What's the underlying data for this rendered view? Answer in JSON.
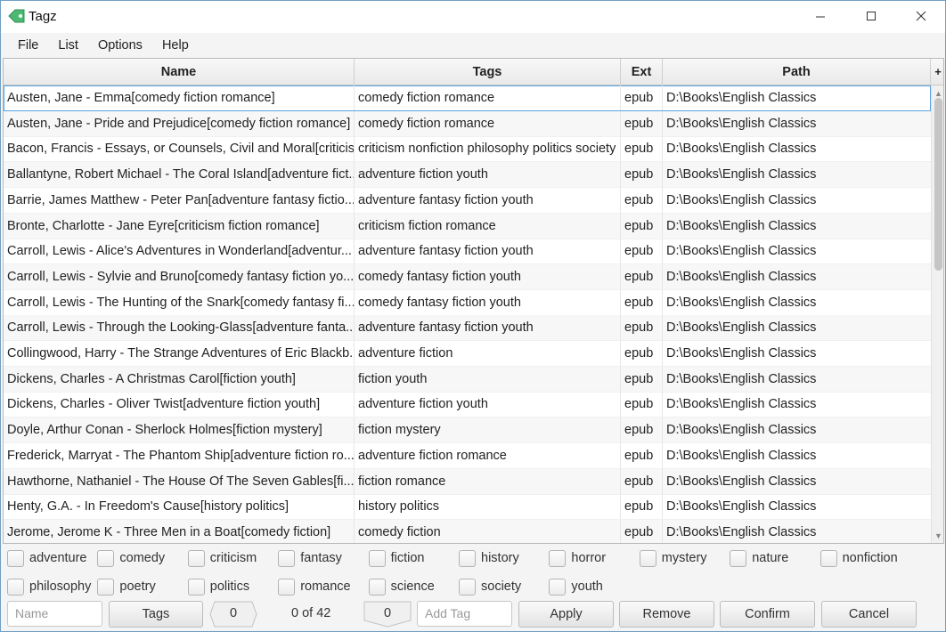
{
  "window": {
    "title": "Tagz",
    "accent": "#6f9fc4"
  },
  "menu": [
    "File",
    "List",
    "Options",
    "Help"
  ],
  "table": {
    "columns": {
      "name": "Name",
      "tags": "Tags",
      "ext": "Ext",
      "path": "Path",
      "add": "+"
    },
    "rows": [
      {
        "name": "Austen, Jane - Emma[comedy fiction romance]",
        "tags": "comedy fiction romance",
        "ext": "epub",
        "path": "D:\\Books\\English Classics"
      },
      {
        "name": "Austen, Jane - Pride and Prejudice[comedy fiction romance]",
        "tags": "comedy fiction romance",
        "ext": "epub",
        "path": "D:\\Books\\English Classics"
      },
      {
        "name": "Bacon, Francis - Essays, or Counsels, Civil and Moral[criticis...",
        "tags": "criticism nonfiction philosophy politics society",
        "ext": "epub",
        "path": "D:\\Books\\English Classics"
      },
      {
        "name": "Ballantyne, Robert Michael - The Coral Island[adventure fict...",
        "tags": "adventure fiction youth",
        "ext": "epub",
        "path": "D:\\Books\\English Classics"
      },
      {
        "name": "Barrie, James Matthew - Peter Pan[adventure fantasy fictio...",
        "tags": "adventure fantasy fiction youth",
        "ext": "epub",
        "path": "D:\\Books\\English Classics"
      },
      {
        "name": "Bronte, Charlotte - Jane Eyre[criticism fiction romance]",
        "tags": "criticism fiction romance",
        "ext": "epub",
        "path": "D:\\Books\\English Classics"
      },
      {
        "name": "Carroll, Lewis  - Alice's Adventures in Wonderland[adventur...",
        "tags": "adventure fantasy fiction youth",
        "ext": "epub",
        "path": "D:\\Books\\English Classics"
      },
      {
        "name": "Carroll, Lewis  - Sylvie and Bruno[comedy fantasy fiction yo...",
        "tags": "comedy fantasy fiction youth",
        "ext": "epub",
        "path": "D:\\Books\\English Classics"
      },
      {
        "name": "Carroll, Lewis  - The Hunting of the Snark[comedy fantasy fi...",
        "tags": "comedy fantasy fiction youth",
        "ext": "epub",
        "path": "D:\\Books\\English Classics"
      },
      {
        "name": "Carroll, Lewis  - Through the Looking-Glass[adventure fanta...",
        "tags": "adventure fantasy fiction youth",
        "ext": "epub",
        "path": "D:\\Books\\English Classics"
      },
      {
        "name": "Collingwood, Harry - The Strange Adventures of Eric Blackb...",
        "tags": "adventure fiction",
        "ext": "epub",
        "path": "D:\\Books\\English Classics"
      },
      {
        "name": "Dickens, Charles - A Christmas Carol[fiction youth]",
        "tags": "fiction youth",
        "ext": "epub",
        "path": "D:\\Books\\English Classics"
      },
      {
        "name": "Dickens, Charles - Oliver Twist[adventure fiction youth]",
        "tags": "adventure fiction youth",
        "ext": "epub",
        "path": "D:\\Books\\English Classics"
      },
      {
        "name": "Doyle, Arthur Conan - Sherlock Holmes[fiction mystery]",
        "tags": "fiction mystery",
        "ext": "epub",
        "path": "D:\\Books\\English Classics"
      },
      {
        "name": "Frederick, Marryat - The Phantom Ship[adventure fiction ro...",
        "tags": "adventure fiction romance",
        "ext": "epub",
        "path": "D:\\Books\\English Classics"
      },
      {
        "name": "Hawthorne, Nathaniel  - The House Of The Seven Gables[fi...",
        "tags": "fiction romance",
        "ext": "epub",
        "path": "D:\\Books\\English Classics"
      },
      {
        "name": "Henty, G.A. - In Freedom's Cause[history politics]",
        "tags": "history politics",
        "ext": "epub",
        "path": "D:\\Books\\English Classics"
      },
      {
        "name": "Jerome, Jerome K - Three Men in a Boat[comedy fiction]",
        "tags": "comedy fiction",
        "ext": "epub",
        "path": "D:\\Books\\English Classics"
      }
    ]
  },
  "tag_checkboxes": [
    "adventure",
    "comedy",
    "criticism",
    "fantasy",
    "fiction",
    "history",
    "horror",
    "mystery",
    "nature",
    "nonfiction",
    "philosophy",
    "poetry",
    "politics",
    "romance",
    "science",
    "society",
    "youth"
  ],
  "toolbar": {
    "name_placeholder": "Name",
    "tags_button": "Tags",
    "left_counter": "0",
    "status": "0 of 42",
    "right_counter": "0",
    "add_tag_placeholder": "Add Tag",
    "apply_button": "Apply",
    "remove_button": "Remove",
    "confirm_button": "Confirm",
    "cancel_button": "Cancel"
  }
}
